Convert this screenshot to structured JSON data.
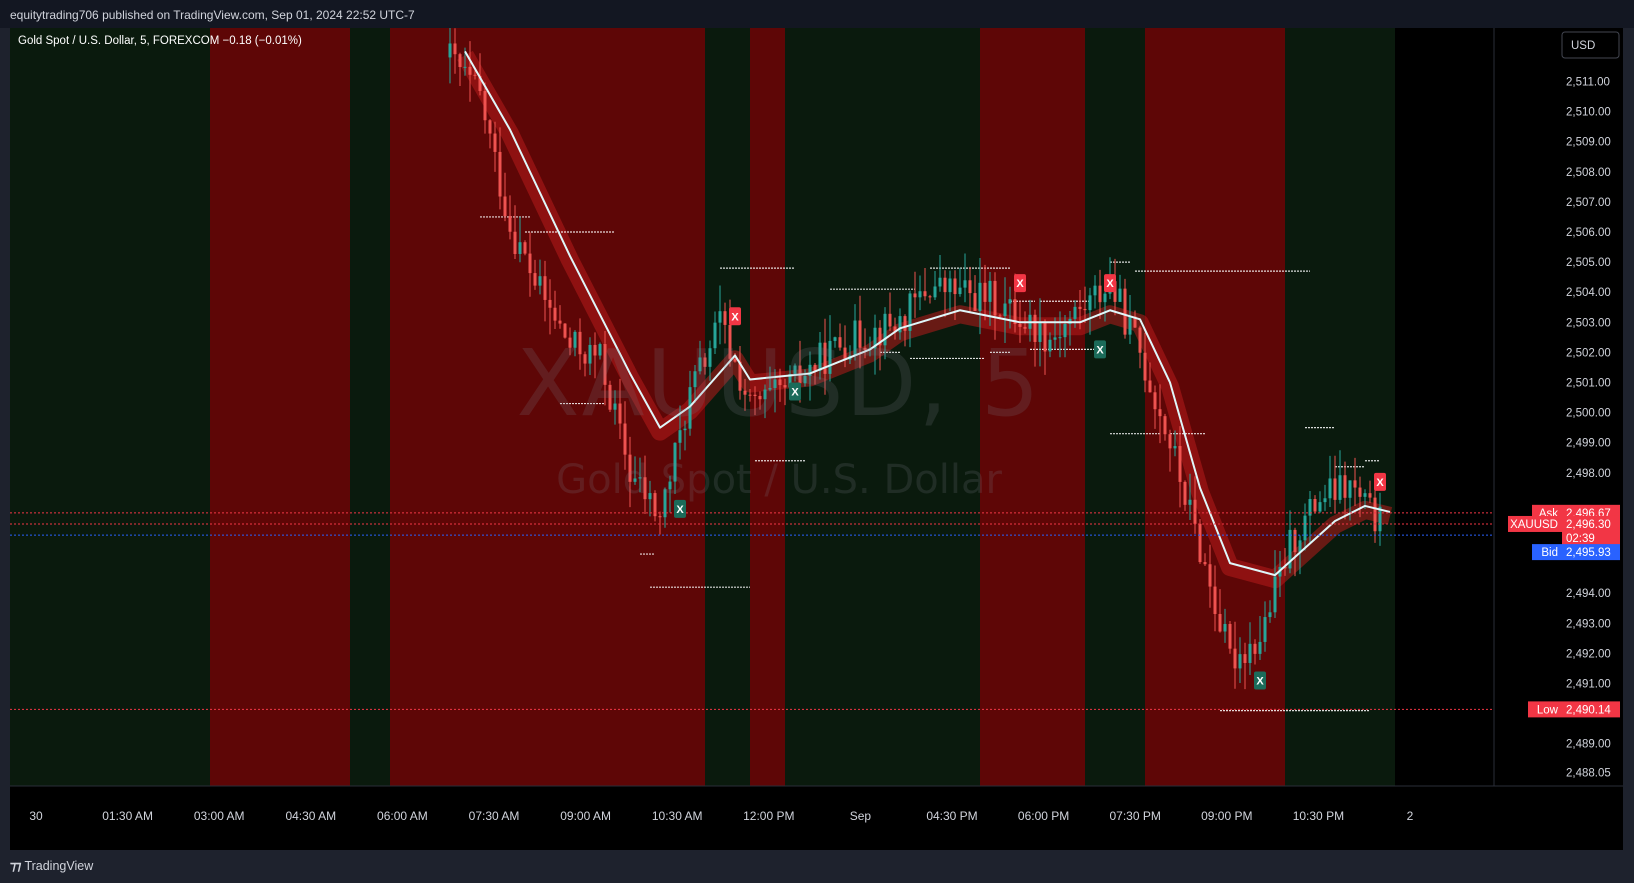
{
  "header": {
    "published": "equitytrading706 published on TradingView.com, Sep 01, 2024 22:52 UTC-7"
  },
  "legend": {
    "symbol_line": "Gold Spot / U.S. Dollar, 5, FOREXCOM",
    "change": "−0.18 (−0.01%)"
  },
  "watermark": {
    "symbol": "XAUUSD, 5",
    "description": "Gold Spot / U.S. Dollar"
  },
  "currency_button": "USD",
  "footer": {
    "brand": "TradingView"
  },
  "colors": {
    "background": "#000000",
    "bull": "#26a69a",
    "bear": "#ef5350",
    "zone_green": "#0a1a0d",
    "zone_red": "#5e0606",
    "ma": "#e0f7fa",
    "ask": "#f23645",
    "bid": "#2962ff",
    "low": "#f23645"
  },
  "chart_data": {
    "type": "candlestick",
    "symbol": "XAUUSD",
    "timeframe": "5",
    "exchange": "FOREXCOM",
    "x_ticks": [
      "30",
      "01:30 AM",
      "03:00 AM",
      "04:30 AM",
      "06:00 AM",
      "07:30 AM",
      "09:00 AM",
      "10:30 AM",
      "12:00 PM",
      "Sep",
      "04:30 PM",
      "06:00 PM",
      "07:30 PM",
      "09:00 PM",
      "10:30 PM",
      "2"
    ],
    "y_ticks": [
      "2,511.00",
      "2,510.00",
      "2,509.00",
      "2,508.00",
      "2,507.00",
      "2,506.00",
      "2,505.00",
      "2,504.00",
      "2,503.00",
      "2,502.00",
      "2,501.00",
      "2,500.00",
      "2,499.00",
      "2,498.00",
      "2,494.00",
      "2,493.00",
      "2,492.00",
      "2,491.00",
      "2,489.00",
      "2,488.05"
    ],
    "ylim": [
      2487.5,
      2512.5
    ],
    "price_labels": [
      {
        "name": "Ask",
        "value": "2,496.67"
      },
      {
        "name": "XAUUSD",
        "value": "2,496.30",
        "countdown": "02:39"
      },
      {
        "name": "Bid",
        "value": "2,495.93"
      },
      {
        "name": "Low",
        "value": "2,490.14"
      }
    ],
    "signals": [
      {
        "label": "X",
        "type": "sell",
        "time": "11:45 AM",
        "price": 2503.2
      },
      {
        "label": "X",
        "type": "buy",
        "time": "12:45 PM",
        "price": 2500.7
      },
      {
        "label": "X",
        "type": "buy",
        "time": "10:50 AM",
        "price": 2496.8
      },
      {
        "label": "X",
        "type": "sell",
        "time": "04:30 PM",
        "price": 2504.3
      },
      {
        "label": "X",
        "type": "buy",
        "time": "05:50 PM",
        "price": 2502.1
      },
      {
        "label": "X",
        "type": "sell",
        "time": "06:00 PM",
        "price": 2504.3
      },
      {
        "label": "X",
        "type": "buy",
        "time": "08:30 PM",
        "price": 2491.1
      },
      {
        "label": "X",
        "type": "sell",
        "time": "10:30 PM",
        "price": 2497.7
      }
    ],
    "zones": [
      {
        "from": "00:00",
        "to": "03:00 AM",
        "color": "green"
      },
      {
        "from": "03:00 AM",
        "to": "05:20 AM",
        "color": "red"
      },
      {
        "from": "05:20 AM",
        "to": "06:00 AM",
        "color": "green"
      },
      {
        "from": "06:00 AM",
        "to": "11:15 AM",
        "color": "red"
      },
      {
        "from": "11:15 AM",
        "to": "12:00 PM",
        "color": "green"
      },
      {
        "from": "12:00 PM",
        "to": "12:35 PM",
        "color": "red"
      },
      {
        "from": "12:35 PM",
        "to": "03:50 PM",
        "color": "green"
      },
      {
        "from": "03:50 PM",
        "to": "05:35 PM",
        "color": "red"
      },
      {
        "from": "05:35 PM",
        "to": "06:35 PM",
        "color": "green"
      },
      {
        "from": "06:35 PM",
        "to": "08:55 PM",
        "color": "red"
      },
      {
        "from": "08:55 PM",
        "to": "10:45 PM",
        "color": "green"
      }
    ],
    "price_path": [
      [
        "07:00 AM",
        2511.8
      ],
      [
        "07:30 AM",
        2510.5
      ],
      [
        "08:00 AM",
        2506.2
      ],
      [
        "08:30 AM",
        2504.0
      ],
      [
        "09:00 AM",
        2502.2
      ],
      [
        "09:30 AM",
        2501.8
      ],
      [
        "10:00 AM",
        2498.0
      ],
      [
        "10:30 AM",
        2496.5
      ],
      [
        "11:00 AM",
        2500.6
      ],
      [
        "11:30 AM",
        2503.0
      ],
      [
        "12:00 PM",
        2500.2
      ],
      [
        "12:30 PM",
        2500.6
      ],
      [
        "01:30 PM",
        2502.3
      ],
      [
        "02:30 PM",
        2503.0
      ],
      [
        "03:00 PM",
        2504.2
      ],
      [
        "04:00 PM",
        2503.8
      ],
      [
        "05:00 PM",
        2502.5
      ],
      [
        "05:30 PM",
        2503.4
      ],
      [
        "06:00 PM",
        2504.3
      ],
      [
        "06:30 PM",
        2502.0
      ],
      [
        "07:00 PM",
        2499.0
      ],
      [
        "07:30 PM",
        2495.5
      ],
      [
        "08:00 PM",
        2491.8
      ],
      [
        "08:30 PM",
        2492.5
      ],
      [
        "09:00 PM",
        2495.6
      ],
      [
        "09:30 PM",
        2497.2
      ],
      [
        "10:00 PM",
        2497.5
      ],
      [
        "10:30 PM",
        2496.3
      ]
    ],
    "moving_average": [
      [
        "07:15 AM",
        2512.0
      ],
      [
        "08:00 AM",
        2509.4
      ],
      [
        "09:00 AM",
        2505.2
      ],
      [
        "10:00 AM",
        2501.3
      ],
      [
        "10:30 AM",
        2499.5
      ],
      [
        "11:00 AM",
        2500.2
      ],
      [
        "11:45 AM",
        2501.9
      ],
      [
        "12:00 PM",
        2501.1
      ],
      [
        "01:00 PM",
        2501.3
      ],
      [
        "02:00 PM",
        2502.1
      ],
      [
        "02:30 PM",
        2502.8
      ],
      [
        "03:30 PM",
        2503.4
      ],
      [
        "04:30 PM",
        2503.0
      ],
      [
        "05:30 PM",
        2503.0
      ],
      [
        "06:00 PM",
        2503.4
      ],
      [
        "06:30 PM",
        2503.1
      ],
      [
        "07:00 PM",
        2501.0
      ],
      [
        "07:30 PM",
        2497.5
      ],
      [
        "08:00 PM",
        2495.0
      ],
      [
        "08:45 PM",
        2494.6
      ],
      [
        "09:15 PM",
        2495.5
      ],
      [
        "09:45 PM",
        2496.4
      ],
      [
        "10:15 PM",
        2496.9
      ],
      [
        "10:40 PM",
        2496.7
      ]
    ],
    "levels": [
      {
        "price": 2506.5,
        "from": "07:30 AM",
        "to": "08:20 AM"
      },
      {
        "price": 2506.0,
        "from": "08:15 AM",
        "to": "09:45 AM"
      },
      {
        "price": 2500.3,
        "from": "08:50 AM",
        "to": "09:35 AM"
      },
      {
        "price": 2495.3,
        "from": "10:10 AM",
        "to": "10:25 AM"
      },
      {
        "price": 2494.2,
        "from": "10:20 AM",
        "to": "12:00 PM"
      },
      {
        "price": 2504.8,
        "from": "11:30 AM",
        "to": "12:45 PM"
      },
      {
        "price": 2498.4,
        "from": "12:05 PM",
        "to": "12:55 PM"
      },
      {
        "price": 2504.1,
        "from": "01:20 PM",
        "to": "02:45 PM"
      },
      {
        "price": 2502.0,
        "from": "02:10 PM",
        "to": "02:30 PM"
      },
      {
        "price": 2501.8,
        "from": "02:40 PM",
        "to": "03:55 PM"
      },
      {
        "price": 2504.8,
        "from": "03:00 PM",
        "to": "04:20 PM"
      },
      {
        "price": 2502.0,
        "from": "04:00 PM",
        "to": "04:20 PM"
      },
      {
        "price": 2503.7,
        "from": "04:20 PM",
        "to": "04:45 PM"
      },
      {
        "price": 2503.7,
        "from": "04:50 PM",
        "to": "05:40 PM"
      },
      {
        "price": 2502.1,
        "from": "04:40 PM",
        "to": "05:55 PM"
      },
      {
        "price": 2505.0,
        "from": "06:00 PM",
        "to": "06:20 PM"
      },
      {
        "price": 2504.7,
        "from": "06:25 PM",
        "to": "09:20 PM"
      },
      {
        "price": 2499.3,
        "from": "06:00 PM",
        "to": "06:50 PM"
      },
      {
        "price": 2499.3,
        "from": "07:00 PM",
        "to": "07:35 PM"
      },
      {
        "price": 2490.1,
        "from": "07:50 PM",
        "to": "10:20 PM"
      },
      {
        "price": 2499.5,
        "from": "09:15 PM",
        "to": "09:45 PM"
      },
      {
        "price": 2498.2,
        "from": "09:45 PM",
        "to": "10:15 PM"
      },
      {
        "price": 2498.4,
        "from": "10:15 PM",
        "to": "10:30 PM"
      }
    ]
  }
}
